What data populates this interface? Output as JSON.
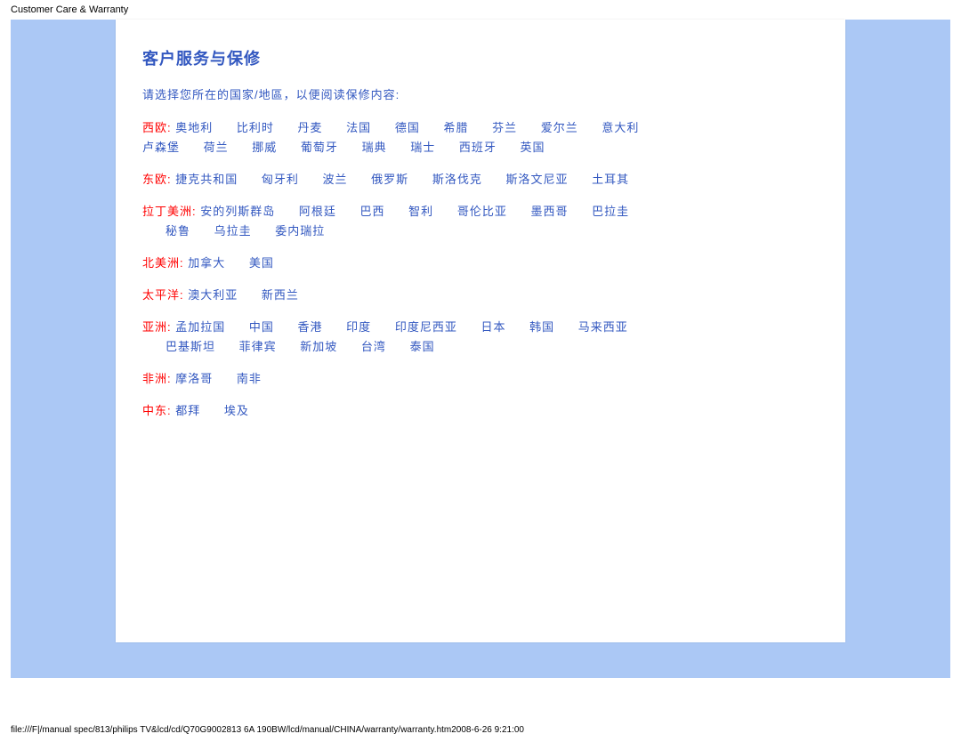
{
  "header": "Customer Care & Warranty",
  "title": "客户服务与保修",
  "intro": "请选择您所在的国家/地區，以便阅读保修内容:",
  "regions": {
    "west_europe": {
      "label": "西欧:",
      "row1": [
        "奥地利",
        "比利时",
        "丹麦",
        "法国",
        "德国",
        "希腊",
        "芬兰",
        "爱尔兰",
        "意大利"
      ],
      "row2": [
        "卢森堡",
        "荷兰",
        "挪威",
        "葡萄牙",
        "瑞典",
        "瑞士",
        "西班牙",
        "英国"
      ]
    },
    "east_europe": {
      "label": "东欧:",
      "row1": [
        "捷克共和国",
        "匈牙利",
        "波兰",
        "俄罗斯",
        "斯洛伐克",
        "斯洛文尼亚",
        "土耳其"
      ]
    },
    "latin": {
      "label": "拉丁美洲:",
      "row1": [
        "安的列斯群岛",
        "阿根廷",
        "巴西",
        "智利",
        "哥伦比亚",
        "墨西哥",
        "巴拉圭"
      ],
      "row2": [
        "秘鲁",
        "乌拉圭",
        "委内瑞拉"
      ]
    },
    "north_america": {
      "label": "北美洲:",
      "row1": [
        "加拿大",
        "美国"
      ]
    },
    "pacific": {
      "label": "太平洋:",
      "row1": [
        "澳大利亚",
        "新西兰"
      ]
    },
    "asia": {
      "label": "亚洲:",
      "row1": [
        "孟加拉国",
        "中国",
        "香港",
        "印度",
        "印度尼西亚",
        "日本",
        "韩国",
        "马来西亚"
      ],
      "row2": [
        "巴基斯坦",
        "菲律宾",
        "新加坡",
        "台湾",
        "泰国"
      ]
    },
    "africa": {
      "label": "非洲:",
      "row1": [
        "摩洛哥",
        "南非"
      ]
    },
    "middle_east": {
      "label": "中东:",
      "row1": [
        "都拜",
        "埃及"
      ]
    }
  },
  "footer": "file:///F|/manual spec/813/philips TV&lcd/cd/Q70G9002813 6A 190BW/lcd/manual/CHINA/warranty/warranty.htm2008-6-26 9:21:00"
}
